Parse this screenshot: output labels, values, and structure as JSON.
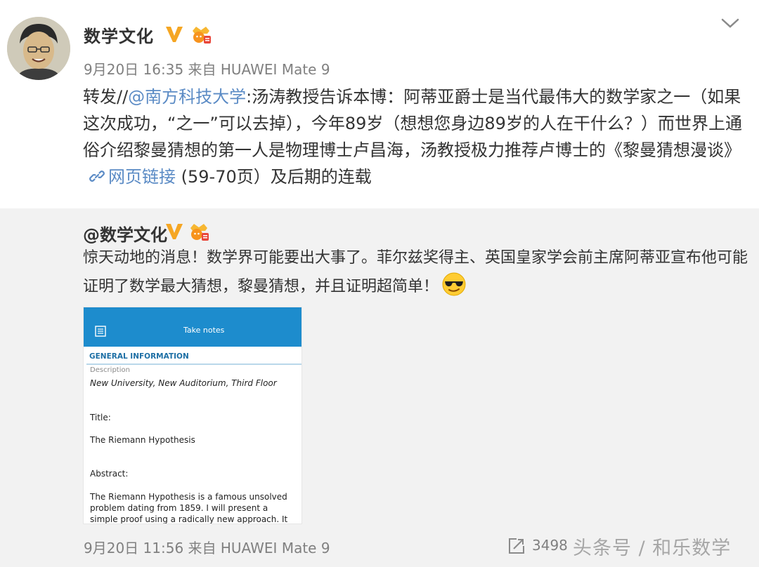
{
  "post": {
    "author": "数学文化",
    "meta": "9月20日 16:35 来自 HUAWEI Mate 9",
    "text_prefix": "转发//",
    "mention": "@南方科技大学",
    "text_body": ":汤涛教授告诉本博：阿蒂亚爵士是当代最伟大的数学家之一（如果这次成功，“之一”可以去掉），今年89岁（想想您身边89岁的人在干什么？）而世界上通俗介绍黎曼猜想的第一人是物理博士卢昌海，汤教授极力推荐卢博士的《黎曼猜想漫谈》",
    "web_link_label": "网页链接",
    "text_suffix": "(59-70页）及后期的连载"
  },
  "retweet": {
    "author": "@数学文化",
    "text": "惊天动地的消息！数学界可能要出大事了。菲尔兹奖得主、英国皇家学会前主席阿蒂亚宣布他可能证明了数学最大猜想，黎曼猜想，并且证明超简单！",
    "screenshot": {
      "app_title": "Take notes",
      "section": "GENERAL INFORMATION",
      "description_label": "Description",
      "description": "New University, New Auditorium, Third Floor",
      "title_label": "Title:",
      "title": "The Riemann Hypothesis",
      "abstract_label": "Abstract:",
      "abstract": "The Riemann Hypothesis is a famous unsolved problem dating from 1859. I will present a simple proof using a radically new approach. It"
    },
    "meta": "9月20日 11:56 来自 HUAWEI Mate 9",
    "share_count": "3498"
  },
  "watermark": "头条号 / 和乐数学",
  "colors": {
    "link": "#5b8bc5",
    "app_bar": "#1d8ccd",
    "retweet_bg": "#f2f2f2",
    "meta": "#808080"
  },
  "icons": [
    "v-verified-icon",
    "crown-badge-icon",
    "chevron-down-icon",
    "link-icon",
    "sunglasses-emoji-icon",
    "share-icon",
    "menu-icon"
  ]
}
